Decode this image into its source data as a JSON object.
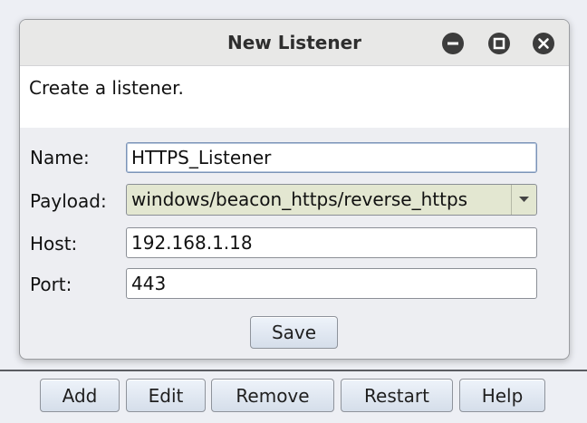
{
  "dialog": {
    "title": "New Listener",
    "description": "Create a listener.",
    "window_controls": [
      "minimize-icon",
      "maximize-icon",
      "close-icon"
    ],
    "fields": {
      "name": {
        "label": "Name:",
        "value": "HTTPS_Listener"
      },
      "payload": {
        "label": "Payload:",
        "value": "windows/beacon_https/reverse_https"
      },
      "host": {
        "label": "Host:",
        "value": "192.168.1.18"
      },
      "port": {
        "label": "Port:",
        "value": "443"
      }
    },
    "save_label": "Save"
  },
  "toolbar": {
    "add_label": "Add",
    "edit_label": "Edit",
    "remove_label": "Remove",
    "restart_label": "Restart",
    "help_label": "Help"
  },
  "colors": {
    "background": "#edeff4",
    "dialog_bg": "#edeef2",
    "combo_bg": "#e3e7d1",
    "button_top": "#eef3fa",
    "button_bottom": "#d5deea"
  }
}
